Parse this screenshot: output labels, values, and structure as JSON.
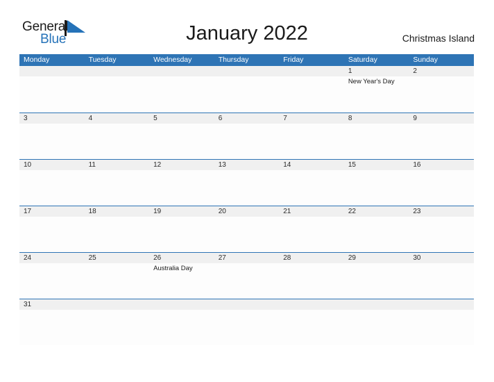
{
  "brand": {
    "name_part1": "General",
    "name_part2": "Blue",
    "mark_icon": "blue-flag-triangle-icon",
    "color_text": "#1a1a1a",
    "color_accent": "#2572b8"
  },
  "header": {
    "title": "January 2022",
    "location": "Christmas Island"
  },
  "theme": {
    "header_blue": "#2e74b5",
    "band_gray": "#f0f0f0",
    "page_background": "#ffffff"
  },
  "calendar": {
    "day_names": [
      "Monday",
      "Tuesday",
      "Wednesday",
      "Thursday",
      "Friday",
      "Saturday",
      "Sunday"
    ],
    "weeks": [
      {
        "days": [
          {
            "date": "",
            "event": ""
          },
          {
            "date": "",
            "event": ""
          },
          {
            "date": "",
            "event": ""
          },
          {
            "date": "",
            "event": ""
          },
          {
            "date": "",
            "event": ""
          },
          {
            "date": "1",
            "event": "New Year's Day"
          },
          {
            "date": "2",
            "event": ""
          }
        ]
      },
      {
        "days": [
          {
            "date": "3",
            "event": ""
          },
          {
            "date": "4",
            "event": ""
          },
          {
            "date": "5",
            "event": ""
          },
          {
            "date": "6",
            "event": ""
          },
          {
            "date": "7",
            "event": ""
          },
          {
            "date": "8",
            "event": ""
          },
          {
            "date": "9",
            "event": ""
          }
        ]
      },
      {
        "days": [
          {
            "date": "10",
            "event": ""
          },
          {
            "date": "11",
            "event": ""
          },
          {
            "date": "12",
            "event": ""
          },
          {
            "date": "13",
            "event": ""
          },
          {
            "date": "14",
            "event": ""
          },
          {
            "date": "15",
            "event": ""
          },
          {
            "date": "16",
            "event": ""
          }
        ]
      },
      {
        "days": [
          {
            "date": "17",
            "event": ""
          },
          {
            "date": "18",
            "event": ""
          },
          {
            "date": "19",
            "event": ""
          },
          {
            "date": "20",
            "event": ""
          },
          {
            "date": "21",
            "event": ""
          },
          {
            "date": "22",
            "event": ""
          },
          {
            "date": "23",
            "event": ""
          }
        ]
      },
      {
        "days": [
          {
            "date": "24",
            "event": ""
          },
          {
            "date": "25",
            "event": ""
          },
          {
            "date": "26",
            "event": "Australia Day"
          },
          {
            "date": "27",
            "event": ""
          },
          {
            "date": "28",
            "event": ""
          },
          {
            "date": "29",
            "event": ""
          },
          {
            "date": "30",
            "event": ""
          }
        ]
      },
      {
        "days": [
          {
            "date": "31",
            "event": ""
          },
          {
            "date": "",
            "event": ""
          },
          {
            "date": "",
            "event": ""
          },
          {
            "date": "",
            "event": ""
          },
          {
            "date": "",
            "event": ""
          },
          {
            "date": "",
            "event": ""
          },
          {
            "date": "",
            "event": ""
          }
        ]
      }
    ]
  }
}
